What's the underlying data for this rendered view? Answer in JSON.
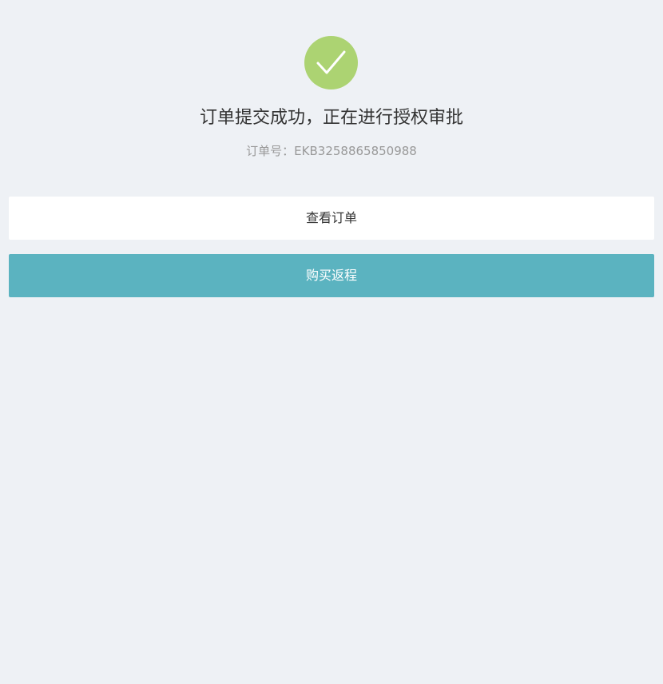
{
  "status": {
    "icon": "checkmark-circle-icon",
    "title": "订单提交成功，正在进行授权审批",
    "order_label": "订单号：",
    "order_number": "EKB3258865850988"
  },
  "actions": {
    "view_order_label": "查看订单",
    "buy_return_label": "购买返程"
  },
  "colors": {
    "background": "#eef1f5",
    "success": "#acd372",
    "primary": "#5bb3c0",
    "secondary_button": "#ffffff"
  }
}
